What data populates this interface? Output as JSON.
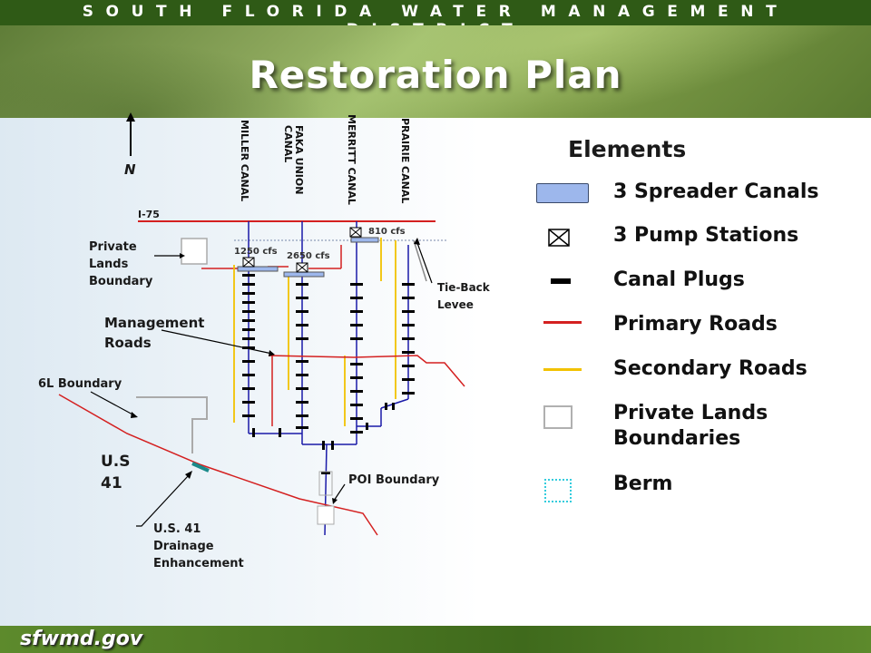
{
  "header": {
    "org": "SOUTH FLORIDA WATER MANAGEMENT DISTRICT",
    "title": "Restoration Plan"
  },
  "footer": {
    "logo_text": "sfwmd.gov"
  },
  "legend": {
    "title": "Elements",
    "items": [
      {
        "label": "3 Spreader Canals",
        "icon": "spreader-canal-swatch",
        "color": "#9db7ec"
      },
      {
        "label": "3 Pump Stations",
        "icon": "pump-station-symbol",
        "color": "#000000"
      },
      {
        "label": "Canal Plugs",
        "icon": "canal-plug-bar",
        "color": "#000000"
      },
      {
        "label": "Primary Roads",
        "icon": "primary-road-line",
        "color": "#d42020"
      },
      {
        "label": "Secondary Roads",
        "icon": "secondary-road-line",
        "color": "#f2c200"
      },
      {
        "label": "Private Lands Boundaries",
        "icon": "private-lands-box",
        "color": "#b0b0b0"
      },
      {
        "label": "Berm",
        "icon": "berm-dotted-box",
        "color": "#33ccdd"
      }
    ]
  },
  "map": {
    "north": "N",
    "highway": "I-75",
    "canals": [
      "MILLER CANAL",
      "FAKA UNION CANAL",
      "MERRITT CANAL",
      "PRAIRIE CANAL"
    ],
    "flows": [
      "1250 cfs",
      "2650 cfs",
      "810 cfs"
    ],
    "labels": {
      "private_lands": "Private Lands Boundary",
      "management_roads": "Management Roads",
      "tie_back": "Tie-Back Levee",
      "boundary_6l": "6L Boundary",
      "us41": "U.S 41",
      "us41_drainage": "U.S. 41 Drainage Enhancement",
      "poi": "POI Boundary"
    }
  }
}
